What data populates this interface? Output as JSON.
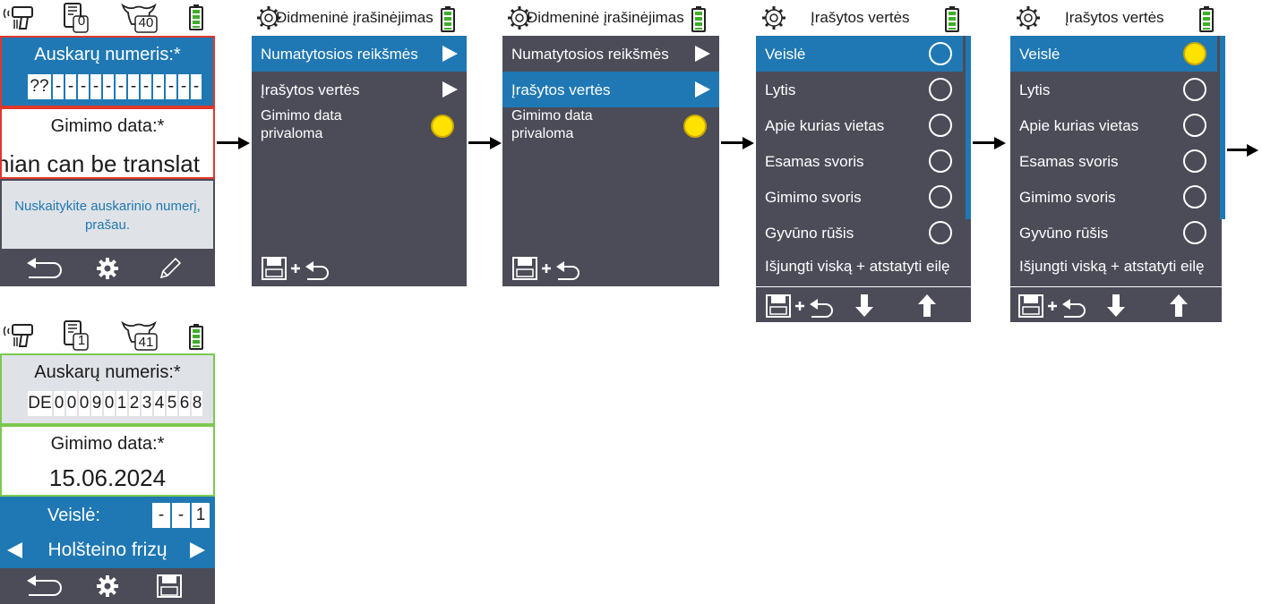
{
  "colors": {
    "accent": "#1f78b4",
    "panel": "#4b4c58",
    "error": "#e0362b",
    "ok": "#7cc84f",
    "battery": "#3fae2a",
    "radio_on": "#ffe200"
  },
  "screen1": {
    "tag_count": "0",
    "animal_count": "40",
    "ear_label": "Auskarų numeris:*",
    "ear_cells": [
      "??",
      "-",
      "-",
      "-",
      "-",
      "-",
      "-",
      "-",
      "-",
      "-",
      "-",
      "-",
      "-"
    ],
    "birth_label": "Gimimo data:*",
    "birth_value": "nian can be translat",
    "message": "Nuskaitykite auskarinio numerį, prašau."
  },
  "screen2": {
    "title": "Ðidmeninė įrašinėjimas",
    "rows": [
      {
        "label": "Numatytosios reikšmės"
      },
      {
        "label": "Įrašytos vertės"
      }
    ],
    "toggle_label_line1": "Gimimo data",
    "toggle_label_line2": "privaloma"
  },
  "screen3": {
    "title": "Ðidmeninė įrašinėjimas",
    "rows": [
      {
        "label": "Numatytosios reikšmės"
      },
      {
        "label": "Įrašytos vertės"
      }
    ],
    "toggle_label_line1": "Gimimo data",
    "toggle_label_line2": "privaloma"
  },
  "screen4": {
    "title": "Įrašytos vertės",
    "rows": [
      "Veislė",
      "Lytis",
      "Apie kurias vietas",
      "Esamas svoris",
      "Gimimo svoris",
      "Gyvūno rūšis"
    ],
    "last_row": "Išjungti viską + atstatyti eilę"
  },
  "screen5": {
    "title": "Įrašytos vertės",
    "rows": [
      "Veislė",
      "Lytis",
      "Apie kurias vietas",
      "Esamas svoris",
      "Gimimo svoris",
      "Gyvūno rūšis"
    ],
    "last_row": "Išjungti viską + atstatyti eilę"
  },
  "screen6": {
    "tag_count": "1",
    "animal_count": "41",
    "ear_label": "Auskarų numeris:*",
    "ear_cells": [
      "DE",
      "0",
      "0",
      "0",
      "9",
      "0",
      "1",
      "2",
      "3",
      "4",
      "5",
      "6",
      "8"
    ],
    "birth_label": "Gimimo data:*",
    "birth_value": "15.06.2024",
    "breed_label": "Veislė:",
    "breed_cells": [
      "-",
      "-",
      "1"
    ],
    "breed_value": "Holšteino frizų"
  }
}
